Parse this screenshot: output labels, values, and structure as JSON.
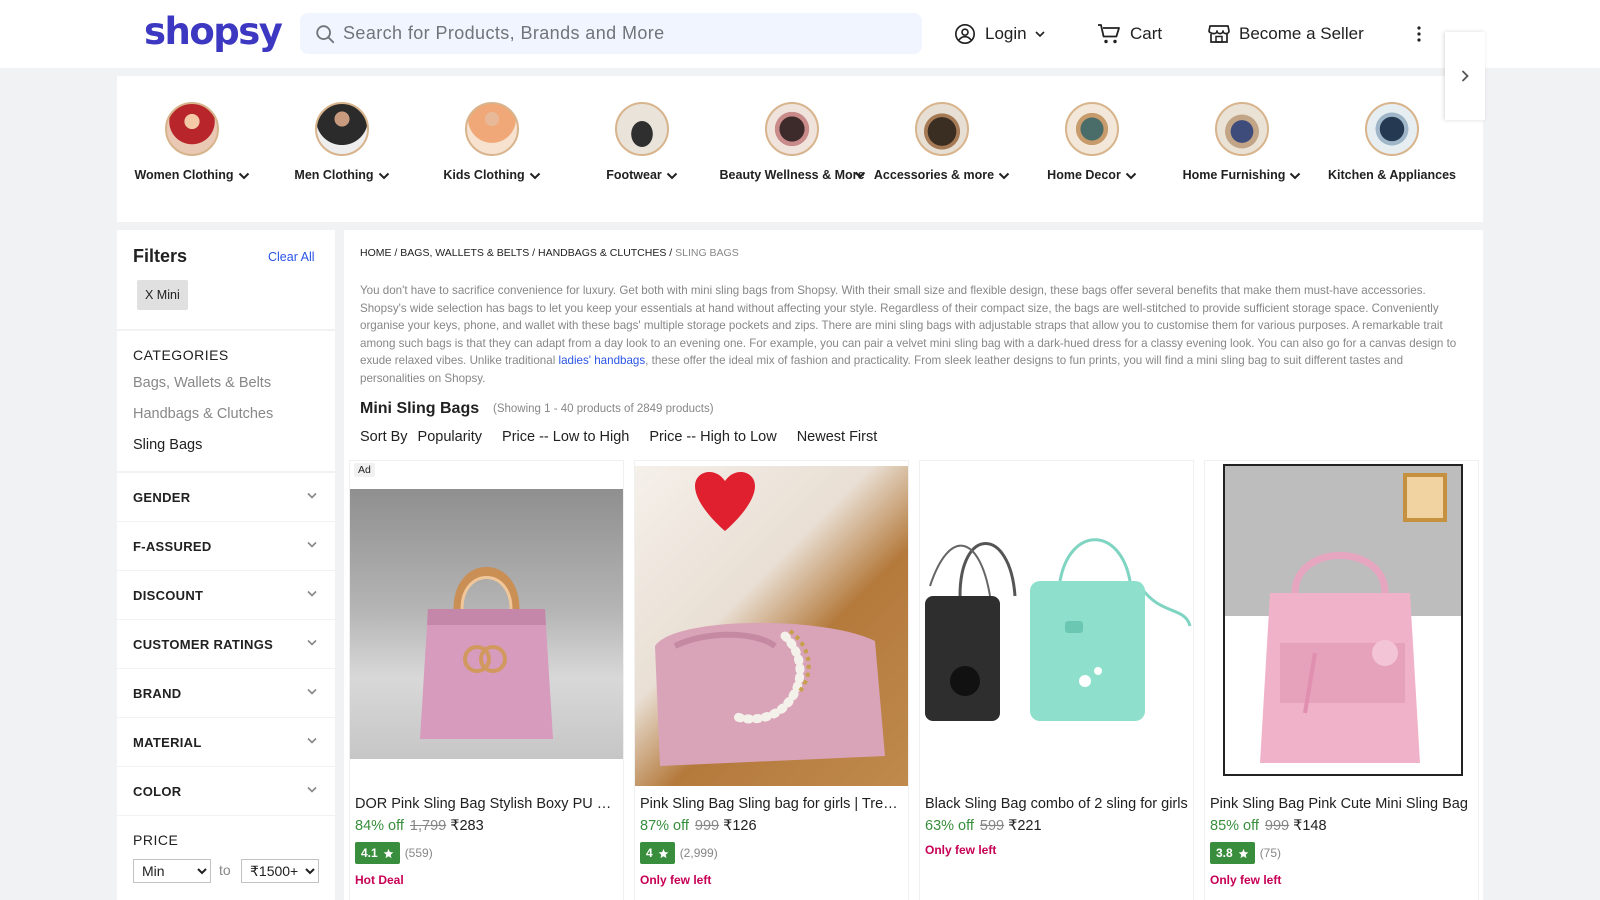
{
  "brand": {
    "logo_text": "shopsy",
    "color": "#3c38c2"
  },
  "header": {
    "search_placeholder": "Search for Products, Brands and More",
    "login_label": "Login",
    "cart_label": "Cart",
    "seller_label": "Become a Seller",
    "icons": [
      "search-icon",
      "user-circle-icon",
      "chevron-down-icon",
      "cart-icon",
      "store-icon",
      "kebab-menu-icon"
    ]
  },
  "categories": [
    {
      "label": "Women Clothing"
    },
    {
      "label": "Men Clothing"
    },
    {
      "label": "Kids Clothing"
    },
    {
      "label": "Footwear"
    },
    {
      "label": "Beauty Wellness & More"
    },
    {
      "label": "Accessories & more"
    },
    {
      "label": "Home Decor"
    },
    {
      "label": "Home Furnishing"
    },
    {
      "label": "Kitchen & Appliances"
    }
  ],
  "filters": {
    "title": "Filters",
    "clear_all": "Clear All",
    "applied_chip": "X  Mini",
    "categories_title": "CATEGORIES",
    "category_links": [
      "Bags, Wallets & Belts",
      "Handbags & Clutches",
      "Sling Bags"
    ],
    "sections": [
      "GENDER",
      "F-ASSURED",
      "DISCOUNT",
      "CUSTOMER RATINGS",
      "BRAND",
      "MATERIAL",
      "COLOR"
    ],
    "price_title": "PRICE",
    "price_min": "Min",
    "price_to": "to",
    "price_max": "₹1500+"
  },
  "breadcrumb": {
    "home": "HOME",
    "level1": "BAGS, WALLETS & BELTS",
    "level2": "HANDBAGS & CLUTCHES",
    "current": "SLING BAGS"
  },
  "description": {
    "part1": "You don't have to sacrifice convenience for luxury. Get both with mini sling bags from Shopsy. With their small size and flexible design, these bags offer several benefits that make them must-have accessories. Shopsy's wide selection has bags to let you keep your essentials at hand without affecting your style. Regardless of their compact size, the bags are well-stitched to provide sufficient storage space. Conveniently organise your keys, phone, and wallet with these bags' multiple storage pockets and zips. There are mini sling bags with adjustable straps that allow you to customise them for various purposes. A remarkable trait among such bags is that they can adapt from a day look to an evening one. For example, you can pair a velvet mini sling bag with a dark-hued dress for a classy evening look. You can also go for a canvas design to exude relaxed vibes. Unlike traditional ",
    "link": "ladies' handbags",
    "part2": ", these offer the ideal mix of fashion and practicality. From sleek leather designs to fun prints, you will find a mini sling bag to suit different tastes and personalities on Shopsy."
  },
  "listing": {
    "title": "Mini Sling Bags",
    "showing": "(Showing 1 - 40 products of 2849 products)",
    "sort_by": "Sort By",
    "sort_options": [
      "Popularity",
      "Price -- Low to High",
      "Price -- High to Low",
      "Newest First"
    ]
  },
  "products": [
    {
      "ad": "Ad",
      "title": "DOR Pink Sling Bag Stylish Boxy PU Sling Bag",
      "off": "84% off",
      "mrp": "1,799",
      "price": "₹283",
      "rating": "4.1",
      "count": "(559)",
      "tag": "Hot Deal",
      "image": "pink-handbag-photo"
    },
    {
      "ad": "",
      "title": "Pink Sling Bag Sling bag for girls | Trendy",
      "off": "87% off",
      "mrp": "999",
      "price": "₹126",
      "rating": "4",
      "count": "(2,999)",
      "tag": "Only few left",
      "image": "pink-pearl-chain-bag-photo"
    },
    {
      "ad": "",
      "title": "Black Sling Bag combo of 2 sling for girls",
      "off": "63% off",
      "mrp": "599",
      "price": "₹221",
      "rating": "",
      "count": "",
      "tag": "Only few left",
      "image": "mobile-sling-bags-photo"
    },
    {
      "ad": "",
      "title": "Pink Sling Bag Pink Cute Mini Sling Bag",
      "off": "85% off",
      "mrp": "999",
      "price": "₹148",
      "rating": "3.8",
      "count": "(75)",
      "tag": "Only few left",
      "image": "pink-mini-backpack-photo"
    }
  ],
  "colors": {
    "accent": "#2a55e5",
    "discount": "#388e3c",
    "rating_bg": "#388e3c",
    "tag": "#c70055",
    "page_bg": "#f1f2f4"
  }
}
